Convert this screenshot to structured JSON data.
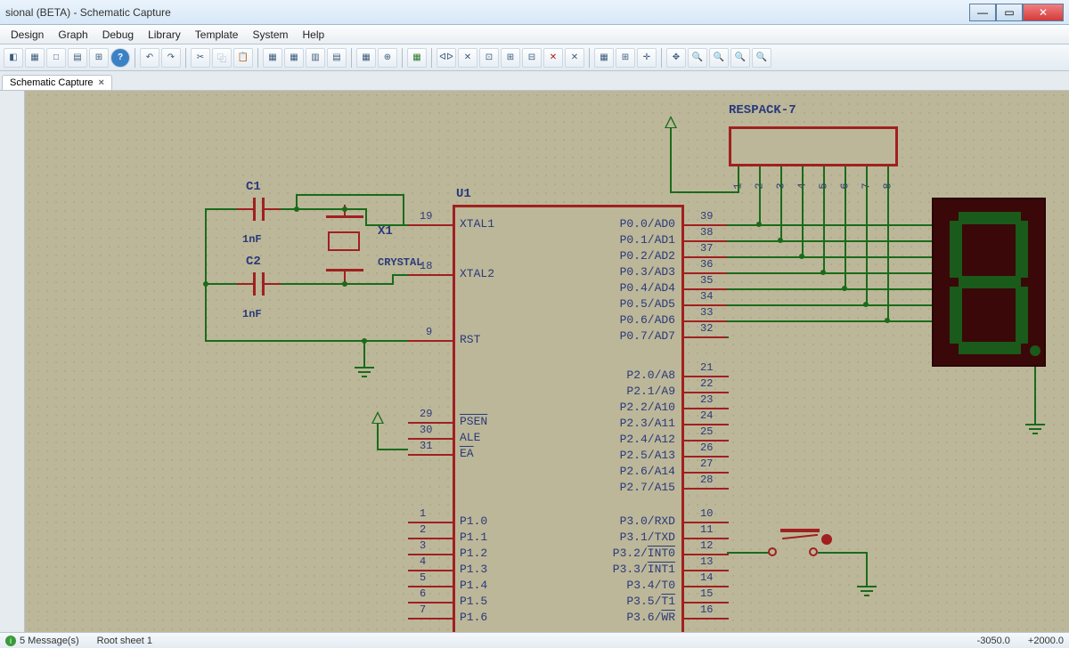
{
  "window": {
    "title": "sional (BETA) - Schematic Capture"
  },
  "menu": [
    "Design",
    "Graph",
    "Debug",
    "Library",
    "Template",
    "System",
    "Help"
  ],
  "tab": {
    "label": "Schematic Capture"
  },
  "components": {
    "c1": {
      "name": "C1",
      "value": "1nF"
    },
    "c2": {
      "name": "C2",
      "value": "1nF"
    },
    "x1": {
      "name": "X1",
      "value": "CRYSTAL"
    },
    "u1": {
      "name": "U1"
    },
    "respack": {
      "name": "RESPACK-7"
    }
  },
  "u1_left_top": [
    {
      "num": "19",
      "label": "XTAL1"
    },
    {
      "num": "18",
      "label": "XTAL2"
    }
  ],
  "u1_left_rst": {
    "num": "9",
    "label": "RST"
  },
  "u1_left_mid": [
    {
      "num": "29",
      "label": "PSEN",
      "ov": true
    },
    {
      "num": "30",
      "label": "ALE"
    },
    {
      "num": "31",
      "label": "EA",
      "ov": true
    }
  ],
  "u1_left_p1": [
    {
      "num": "1",
      "label": "P1.0"
    },
    {
      "num": "2",
      "label": "P1.1"
    },
    {
      "num": "3",
      "label": "P1.2"
    },
    {
      "num": "4",
      "label": "P1.3"
    },
    {
      "num": "5",
      "label": "P1.4"
    },
    {
      "num": "6",
      "label": "P1.5"
    },
    {
      "num": "7",
      "label": "P1.6"
    }
  ],
  "u1_right_p0": [
    {
      "num": "39",
      "label": "P0.0/AD0"
    },
    {
      "num": "38",
      "label": "P0.1/AD1"
    },
    {
      "num": "37",
      "label": "P0.2/AD2"
    },
    {
      "num": "36",
      "label": "P0.3/AD3"
    },
    {
      "num": "35",
      "label": "P0.4/AD4"
    },
    {
      "num": "34",
      "label": "P0.5/AD5"
    },
    {
      "num": "33",
      "label": "P0.6/AD6"
    },
    {
      "num": "32",
      "label": "P0.7/AD7"
    }
  ],
  "u1_right_p2": [
    {
      "num": "21",
      "label": "P2.0/A8"
    },
    {
      "num": "22",
      "label": "P2.1/A9"
    },
    {
      "num": "23",
      "label": "P2.2/A10"
    },
    {
      "num": "24",
      "label": "P2.3/A11"
    },
    {
      "num": "25",
      "label": "P2.4/A12"
    },
    {
      "num": "26",
      "label": "P2.5/A13"
    },
    {
      "num": "27",
      "label": "P2.6/A14"
    },
    {
      "num": "28",
      "label": "P2.7/A15"
    }
  ],
  "u1_right_p3": [
    {
      "num": "10",
      "label": "P3.0/RXD"
    },
    {
      "num": "11",
      "label": "P3.1/TXD"
    },
    {
      "num": "12",
      "label": "P3.2/INT0",
      "ov_part": "INT0"
    },
    {
      "num": "13",
      "label": "P3.3/INT1",
      "ov_part": "INT1"
    },
    {
      "num": "14",
      "label": "P3.4/T0"
    },
    {
      "num": "15",
      "label": "P3.5/T1",
      "ov_part": "T1"
    },
    {
      "num": "16",
      "label": "P3.6/WR",
      "ov_part": "WR"
    }
  ],
  "respack_pins": [
    "1",
    "2",
    "3",
    "4",
    "5",
    "6",
    "7",
    "8"
  ],
  "status": {
    "messages": "5 Message(s)",
    "sheet": "Root sheet 1",
    "coord1": "-3050.0",
    "coord2": "+2000.0"
  }
}
